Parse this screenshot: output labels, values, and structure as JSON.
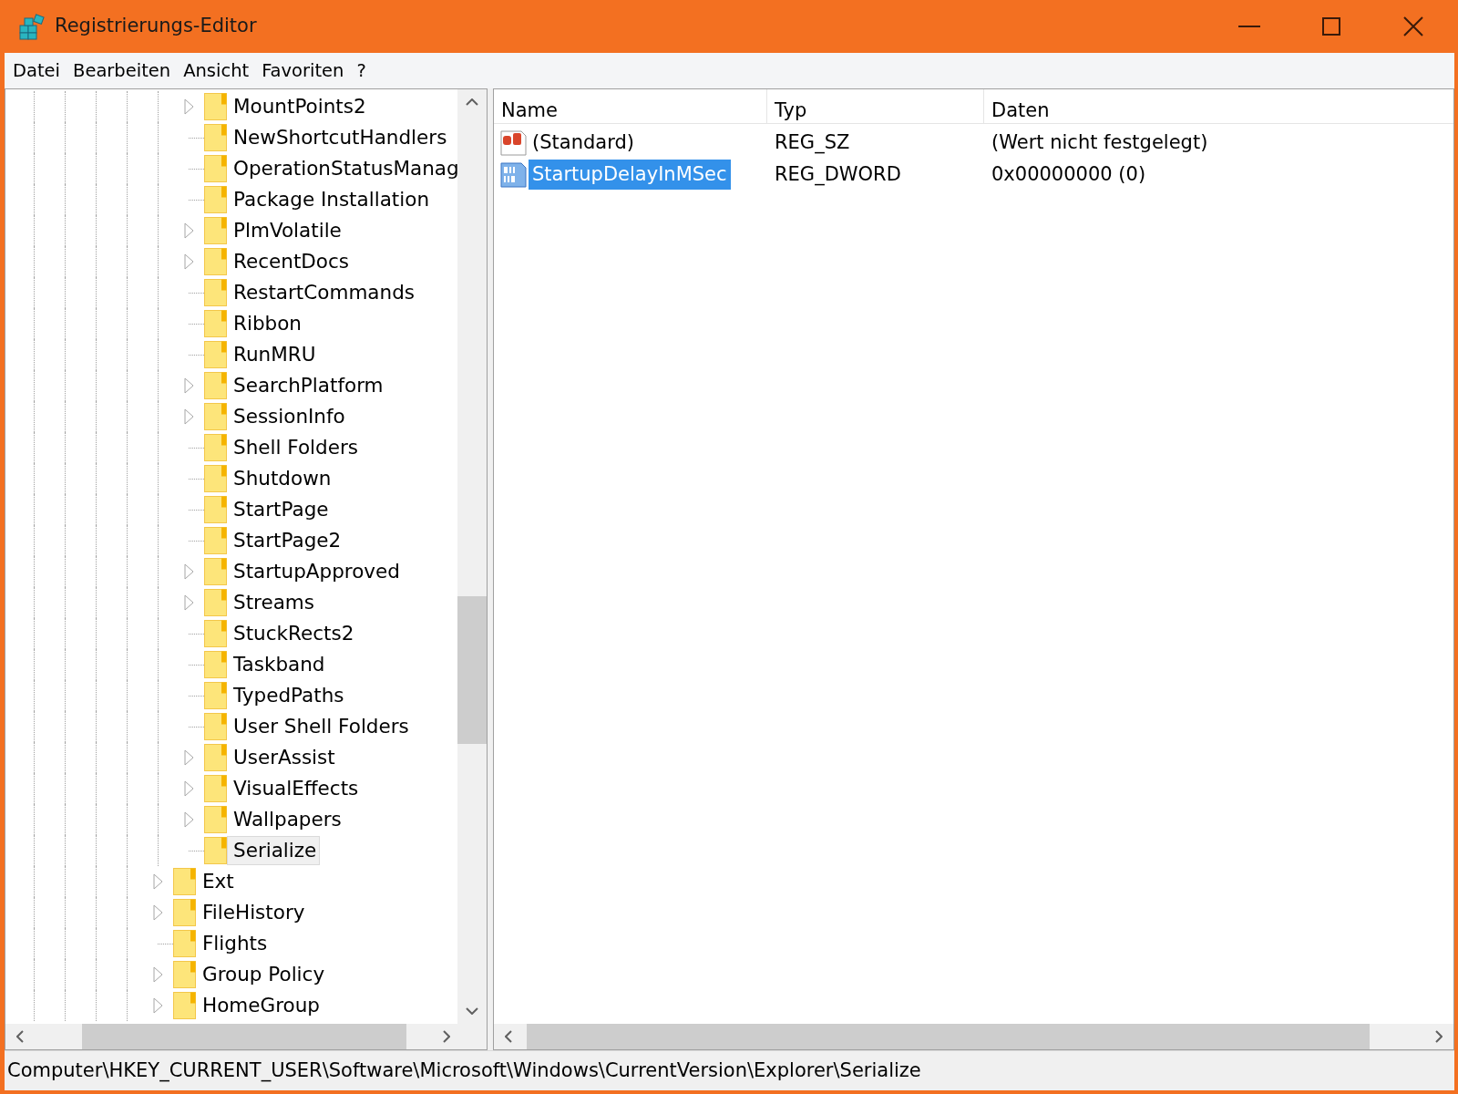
{
  "window": {
    "title": "Registrierungs-Editor"
  },
  "menu": [
    "Datei",
    "Bearbeiten",
    "Ansicht",
    "Favoriten",
    "?"
  ],
  "tree": {
    "items": [
      {
        "children": [
          {
            "label": "MountPoints2",
            "expandable": true,
            "selected": false
          },
          {
            "label": "NewShortcutHandlers",
            "expandable": false,
            "selected": false
          },
          {
            "label": "OperationStatusManag",
            "expandable": false,
            "selected": false
          },
          {
            "label": "Package Installation",
            "expandable": false,
            "selected": false
          },
          {
            "label": "PlmVolatile",
            "expandable": true,
            "selected": false
          },
          {
            "label": "RecentDocs",
            "expandable": true,
            "selected": false
          },
          {
            "label": "RestartCommands",
            "expandable": false,
            "selected": false
          },
          {
            "label": "Ribbon",
            "expandable": false,
            "selected": false
          },
          {
            "label": "RunMRU",
            "expandable": false,
            "selected": false
          },
          {
            "label": "SearchPlatform",
            "expandable": true,
            "selected": false
          },
          {
            "label": "SessionInfo",
            "expandable": true,
            "selected": false
          },
          {
            "label": "Shell Folders",
            "expandable": false,
            "selected": false
          },
          {
            "label": "Shutdown",
            "expandable": false,
            "selected": false
          },
          {
            "label": "StartPage",
            "expandable": false,
            "selected": false
          },
          {
            "label": "StartPage2",
            "expandable": false,
            "selected": false
          },
          {
            "label": "StartupApproved",
            "expandable": true,
            "selected": false
          },
          {
            "label": "Streams",
            "expandable": true,
            "selected": false
          },
          {
            "label": "StuckRects2",
            "expandable": false,
            "selected": false
          },
          {
            "label": "Taskband",
            "expandable": false,
            "selected": false
          },
          {
            "label": "TypedPaths",
            "expandable": false,
            "selected": false
          },
          {
            "label": "User Shell Folders",
            "expandable": false,
            "selected": false
          },
          {
            "label": "UserAssist",
            "expandable": true,
            "selected": false
          },
          {
            "label": "VisualEffects",
            "expandable": true,
            "selected": false
          },
          {
            "label": "Wallpapers",
            "expandable": true,
            "selected": false
          },
          {
            "label": "Serialize",
            "expandable": false,
            "selected": true
          }
        ]
      },
      {
        "label": "Ext",
        "expandable": true,
        "selected": false
      },
      {
        "label": "FileHistory",
        "expandable": true,
        "selected": false
      },
      {
        "label": "Flights",
        "expandable": false,
        "selected": false
      },
      {
        "label": "Group Policy",
        "expandable": true,
        "selected": false
      },
      {
        "label": "HomeGroup",
        "expandable": true,
        "selected": false
      }
    ]
  },
  "values": {
    "columns": [
      "Name",
      "Typ",
      "Daten"
    ],
    "rows": [
      {
        "kind": "string",
        "name": "(Standard)",
        "type": "REG_SZ",
        "data": "(Wert nicht festgelegt)",
        "selected": false
      },
      {
        "kind": "dword",
        "name": "StartupDelayInMSec",
        "type": "REG_DWORD",
        "data": "0x00000000 (0)",
        "selected": true
      }
    ]
  },
  "status_bar": "Computer\\HKEY_CURRENT_USER\\Software\\Microsoft\\Windows\\CurrentVersion\\Explorer\\Serialize"
}
